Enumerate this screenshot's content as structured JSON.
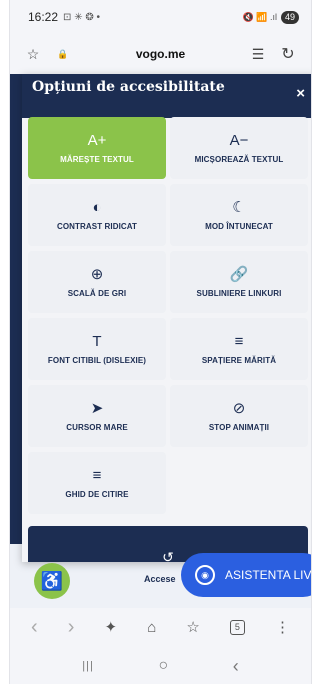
{
  "status": {
    "time": "16:22",
    "left_icons": "⊡ ✳ ❂ •",
    "right_icons": "🔇 📶 .ıl",
    "battery": "49"
  },
  "browser": {
    "domain": "vogo.me",
    "star_icon": "☆",
    "lock_icon": "🔒",
    "reader_icon": "☰",
    "reload_icon": "↻"
  },
  "panel": {
    "title": "Opțiuni de accesibilitate",
    "close": "×",
    "tiles": [
      {
        "icon": "A+",
        "label": "MĂREȘTE TEXTUL",
        "active": true
      },
      {
        "icon": "A−",
        "label": "MICȘOREAZĂ TEXTUL"
      },
      {
        "icon": "◐",
        "label": "CONTRAST RIDICAT"
      },
      {
        "icon": "☾",
        "label": "MOD ÎNTUNECAT"
      },
      {
        "icon": "⊕",
        "label": "SCALĂ DE GRI"
      },
      {
        "icon": "🔗",
        "label": "SUBLINIERE LINKURI"
      },
      {
        "icon": "T",
        "label": "FONT CITIBIL (DISLEXIE)"
      },
      {
        "icon": "≡",
        "label": "SPAȚIERE MĂRITĂ"
      },
      {
        "icon": "➤",
        "label": "CURSOR MARE"
      },
      {
        "icon": "⊘",
        "label": "STOP ANIMAȚII"
      },
      {
        "icon": "≡",
        "label": "GHID DE CITIRE"
      }
    ],
    "reset_icon": "↺"
  },
  "floating": {
    "accessibility_icon": "♿",
    "access_text": "Accese",
    "live_label": "ASISTENTA LIVE"
  },
  "browser_nav": {
    "back": "‹",
    "forward": "›",
    "sparkle": "✦",
    "home": "⌂",
    "bookmarks": "☆",
    "tabs": "5",
    "menu": "⋮"
  },
  "system_nav": {
    "recents": "|||",
    "home": "○",
    "back": "‹"
  },
  "colors": {
    "navy": "#1c2d52",
    "green": "#8bc34a",
    "blue": "#2b5fe0"
  }
}
